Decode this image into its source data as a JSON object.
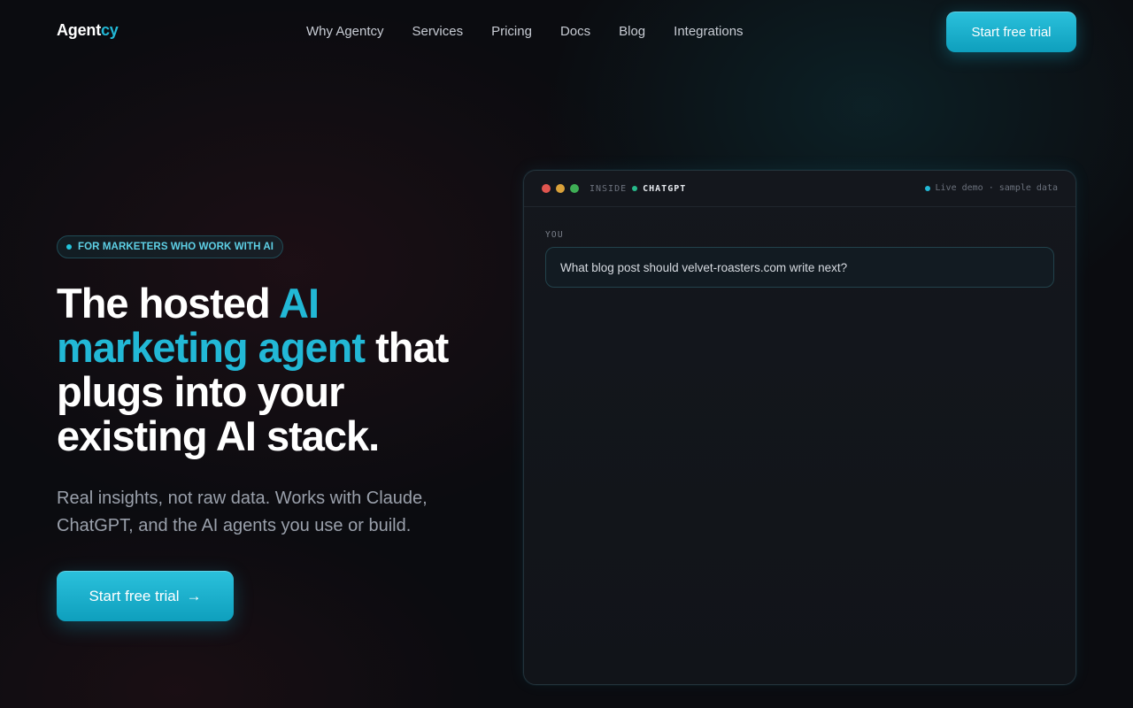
{
  "nav": {
    "logo_main": "Agent",
    "logo_accent": "cy",
    "links": [
      "Why Agentcy",
      "Services",
      "Pricing",
      "Docs",
      "Blog",
      "Integrations"
    ],
    "cta_label": "Start free trial"
  },
  "hero": {
    "badge": "FOR MARKETERS WHO WORK WITH AI",
    "headline_pre": "The hosted ",
    "headline_highlight": "AI marketing agent",
    "headline_post": " that plugs into your existing AI stack.",
    "subtitle": "Real insights, not raw data. Works with Claude, ChatGPT, and the AI agents you use or build.",
    "cta_label": "Start free trial",
    "cta_arrow": "→"
  },
  "demo": {
    "inside_label": "INSIDE",
    "app_name": "CHATGPT",
    "status": "Live demo · sample data",
    "you_label": "YOU",
    "user_message": "What blog post should velvet-roasters.com write next?"
  },
  "colors": {
    "accent": "#22b8d6",
    "background": "#0b0c10",
    "traffic_red": "#e0554f",
    "traffic_yellow": "#d9a13a",
    "traffic_green": "#3eae55"
  }
}
